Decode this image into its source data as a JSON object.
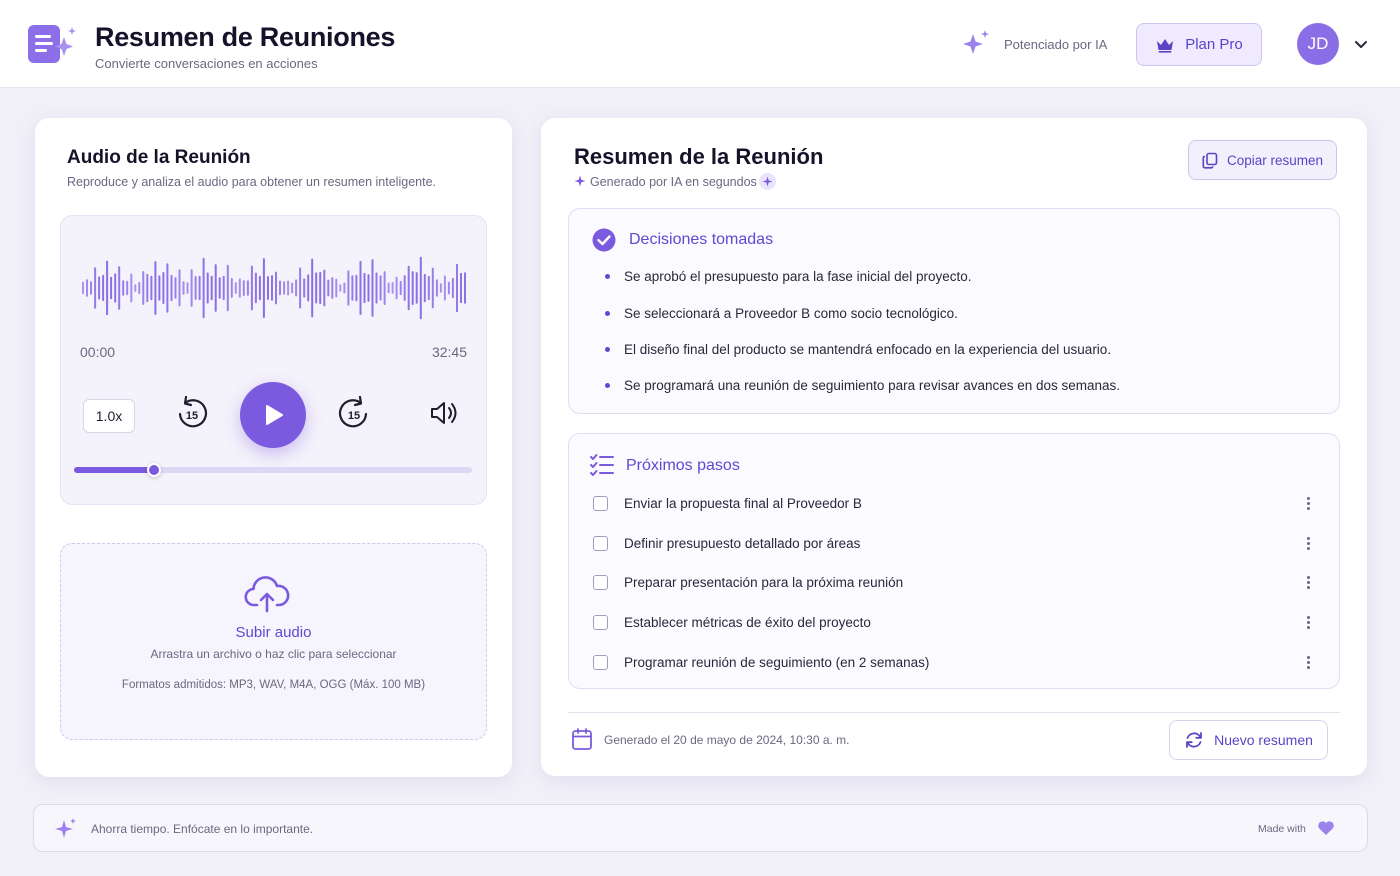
{
  "header": {
    "title": "Resumen de Reuniones",
    "subtitle": "Convierte conversaciones en acciones",
    "ai_label": "Potenciado por IA",
    "plan_label": "Plan Pro",
    "avatar_initials": "JD"
  },
  "audio": {
    "title": "Audio de la Reunión",
    "subtitle": "Reproduce y analiza el audio para obtener un resumen inteligente.",
    "time_current": "00:00",
    "time_total": "32:45",
    "speed": "1.0x",
    "rewind_label": "15",
    "forward_label": "15",
    "progress_fraction": 0.2
  },
  "upload": {
    "title": "Subir audio",
    "hint": "Arrastra un archivo o haz clic para seleccionar",
    "formats": "Formatos admitidos: MP3, WAV, M4A, OGG (Máx. 100 MB)"
  },
  "summary": {
    "title": "Resumen de la Reunión",
    "generated_by": "Generado por IA en segundos",
    "copy_label": "Copiar resumen",
    "decisions": {
      "title": "Decisiones tomadas",
      "items": [
        "Se aprobó el presupuesto para la fase inicial del proyecto.",
        "Se seleccionará a Proveedor B como socio tecnológico.",
        "El diseño final del producto se mantendrá enfocado en la experiencia del usuario.",
        "Se programará una reunión de seguimiento para revisar avances en dos semanas."
      ]
    },
    "steps": {
      "title": "Próximos pasos",
      "items": [
        "Enviar la propuesta final al Proveedor B",
        "Definir presupuesto detallado por áreas",
        "Preparar presentación para la próxima reunión",
        "Establecer métricas de éxito del proyecto",
        "Programar reunión de seguimiento (en 2 semanas)"
      ]
    },
    "generated_date": "Generado el 20 de mayo de 2024, 10:30 a. m.",
    "new_label": "Nuevo resumen"
  },
  "footer": {
    "text": "Ahorra tiempo. Enfócate en lo importante.",
    "made_with": "Made with"
  },
  "colors": {
    "accent": "#7c5ae0",
    "accent_text": "#6248d0",
    "background": "#f1f0f8"
  },
  "icons": [
    "document-sparkle-icon",
    "sparkle-icon",
    "crown-icon",
    "chevron-down-icon",
    "waveform-icon",
    "rewind-15-icon",
    "play-icon",
    "forward-15-icon",
    "volume-icon",
    "cloud-upload-icon",
    "copy-icon",
    "check-circle-icon",
    "checklist-icon",
    "kebab-icon",
    "calendar-icon",
    "refresh-icon",
    "heart-icon"
  ]
}
